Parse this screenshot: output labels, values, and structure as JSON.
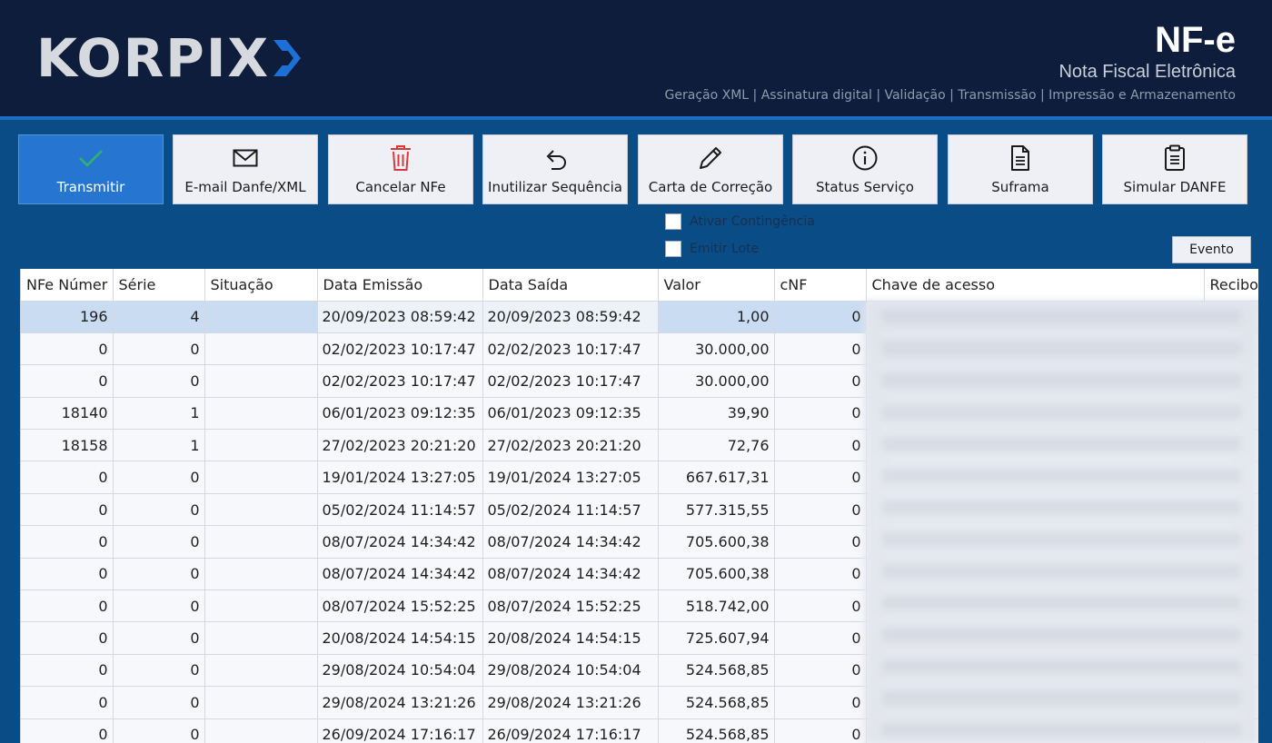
{
  "header": {
    "logo_text": "KORPIX",
    "title": "NF-e",
    "subtitle": "Nota Fiscal Eletrônica",
    "features": "Geração XML | Assinatura digital | Validação | Transmissão | Impressão e Armazenamento"
  },
  "toolbar": {
    "transmitir": "Transmitir",
    "email": "E-mail Danfe/XML",
    "cancelar": "Cancelar NFe",
    "inutilizar": "Inutilizar Sequência",
    "carta": "Carta de Correção",
    "status": "Status Serviço",
    "suframa": "Suframa",
    "simular": "Simular DANFE"
  },
  "options": {
    "contingencia": "Ativar Contingência",
    "lote": "Emitir Lote",
    "evento": "Evento"
  },
  "grid": {
    "columns": [
      "NFe Númer",
      "Série",
      "Situação",
      "Data Emissão",
      "Data Saída",
      "Valor",
      "cNF",
      "Chave de acesso",
      "Recibo"
    ],
    "rows": [
      [
        "196",
        "4",
        "",
        "20/09/2023 08:59:42",
        "20/09/2023 08:59:42",
        "1,00",
        "0"
      ],
      [
        "0",
        "0",
        "",
        "02/02/2023 10:17:47",
        "02/02/2023 10:17:47",
        "30.000,00",
        "0"
      ],
      [
        "0",
        "0",
        "",
        "02/02/2023 10:17:47",
        "02/02/2023 10:17:47",
        "30.000,00",
        "0"
      ],
      [
        "18140",
        "1",
        "",
        "06/01/2023 09:12:35",
        "06/01/2023 09:12:35",
        "39,90",
        "0"
      ],
      [
        "18158",
        "1",
        "",
        "27/02/2023 20:21:20",
        "27/02/2023 20:21:20",
        "72,76",
        "0"
      ],
      [
        "0",
        "0",
        "",
        "19/01/2024 13:27:05",
        "19/01/2024 13:27:05",
        "667.617,31",
        "0"
      ],
      [
        "0",
        "0",
        "",
        "05/02/2024 11:14:57",
        "05/02/2024 11:14:57",
        "577.315,55",
        "0"
      ],
      [
        "0",
        "0",
        "",
        "08/07/2024 14:34:42",
        "08/07/2024 14:34:42",
        "705.600,38",
        "0"
      ],
      [
        "0",
        "0",
        "",
        "08/07/2024 14:34:42",
        "08/07/2024 14:34:42",
        "705.600,38",
        "0"
      ],
      [
        "0",
        "0",
        "",
        "08/07/2024 15:52:25",
        "08/07/2024 15:52:25",
        "518.742,00",
        "0"
      ],
      [
        "0",
        "0",
        "",
        "20/08/2024 14:54:15",
        "20/08/2024 14:54:15",
        "725.607,94",
        "0"
      ],
      [
        "0",
        "0",
        "",
        "29/08/2024 10:54:04",
        "29/08/2024 10:54:04",
        "524.568,85",
        "0"
      ],
      [
        "0",
        "0",
        "",
        "29/08/2024 13:21:26",
        "29/08/2024 13:21:26",
        "524.568,85",
        "0"
      ],
      [
        "0",
        "0",
        "",
        "26/09/2024 17:16:17",
        "26/09/2024 17:16:17",
        "524.568,85",
        "0"
      ]
    ]
  }
}
